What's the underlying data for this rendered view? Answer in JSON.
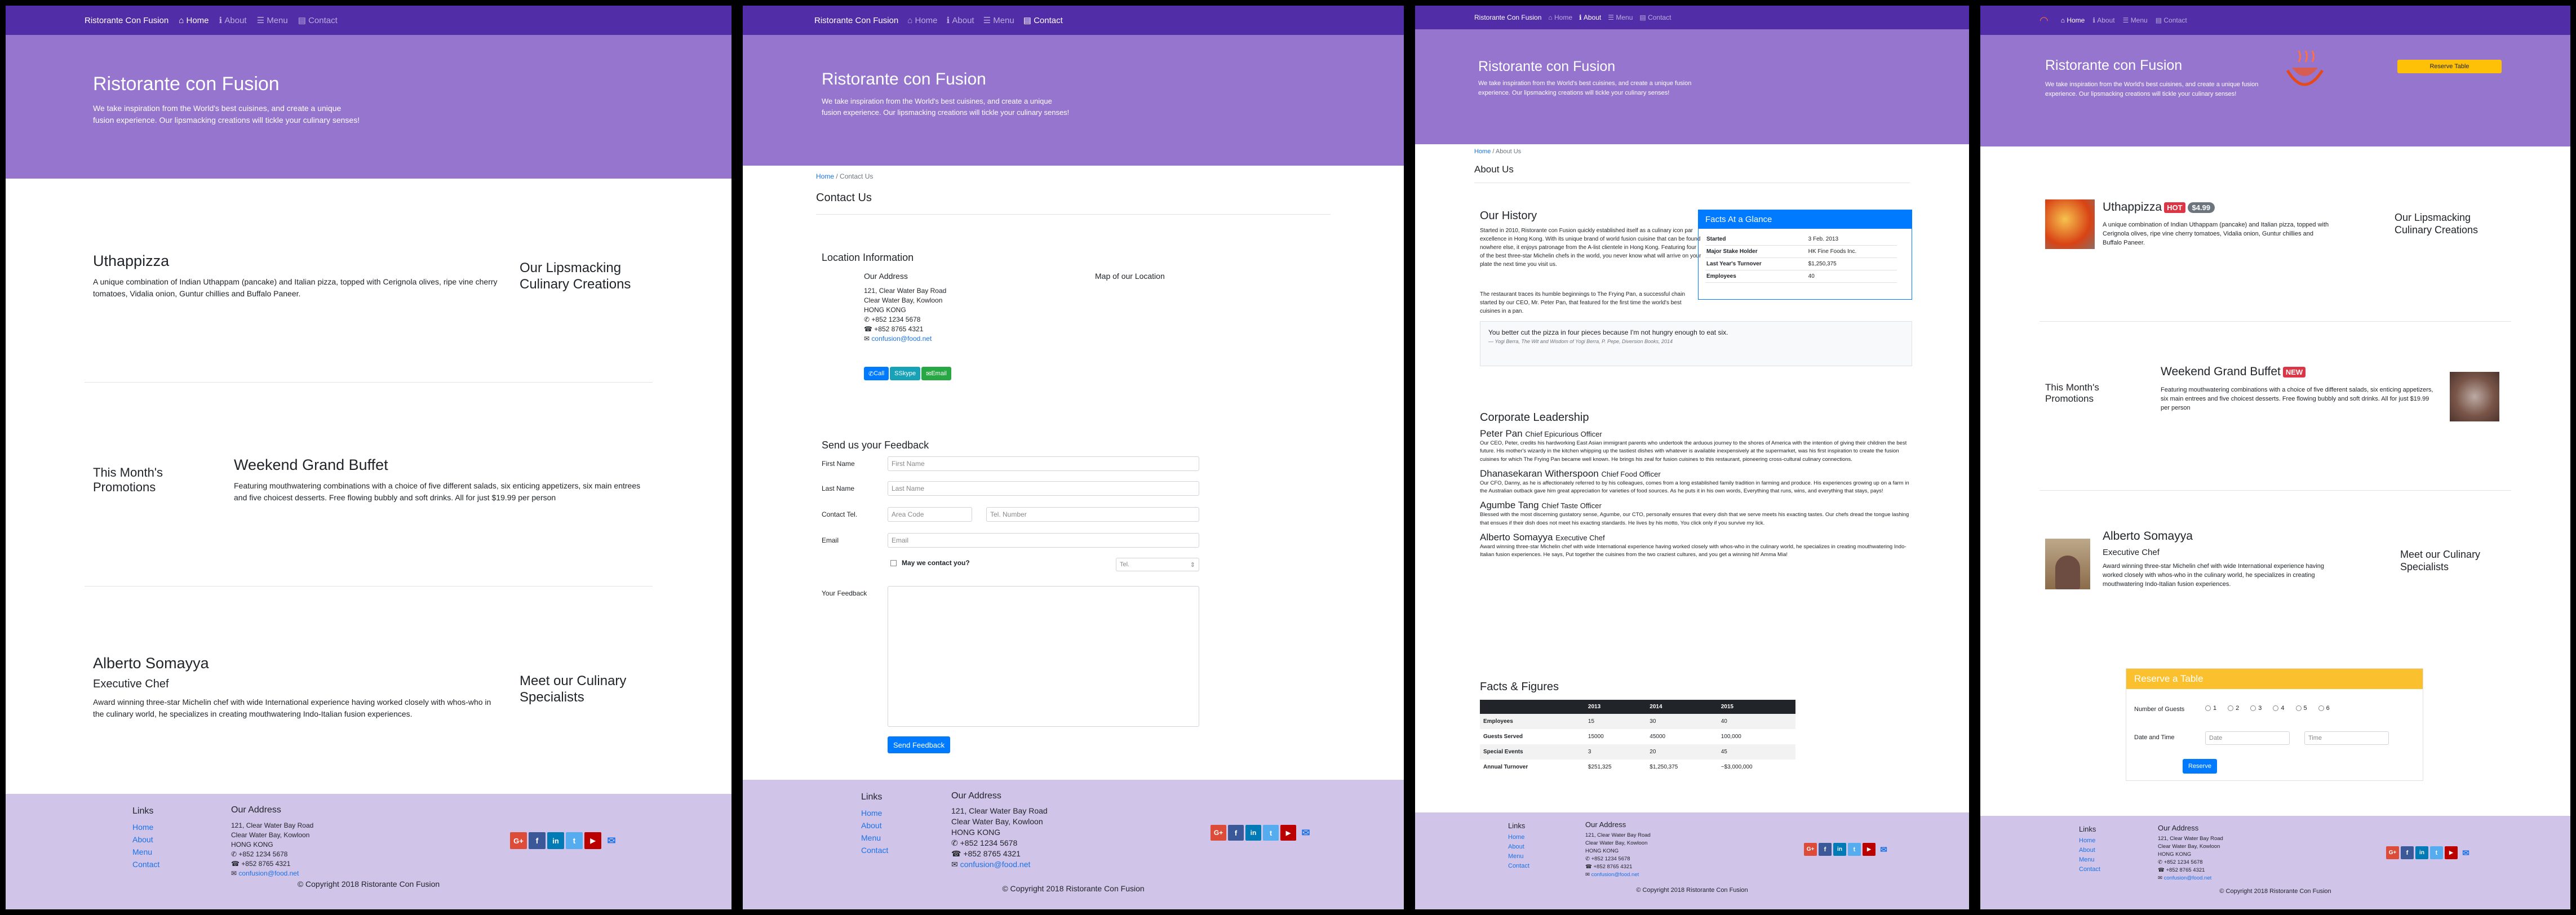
{
  "site": {
    "brand": "Ristorante Con Fusion",
    "nav": {
      "home": "Home",
      "about": "About",
      "menu": "Menu",
      "contact": "Contact"
    },
    "jumbo_title": "Ristorante con Fusion",
    "jumbo_text": "We take inspiration from the World's best cuisines, and create a unique fusion experience. Our lipsmacking creations will tickle your culinary senses!",
    "colors": {
      "nav": "#512da8",
      "jumbotron": "#9575cd",
      "footer": "#d1c4e9",
      "link": "#1a73e8"
    }
  },
  "footer": {
    "links_title": "Links",
    "links": [
      "Home",
      "About",
      "Menu",
      "Contact"
    ],
    "address_title": "Our Address",
    "address": [
      "121, Clear Water Bay Road",
      "Clear Water Bay, Kowloon",
      "HONG KONG"
    ],
    "phone": "+852 1234 5678",
    "fax": "+852 8765 4321",
    "email": "confusion@food.net",
    "copyright": "© Copyright 2018 Ristorante Con Fusion",
    "social": [
      "google-plus-icon",
      "facebook-icon",
      "linkedin-icon",
      "twitter-icon",
      "youtube-icon",
      "mail-icon"
    ]
  },
  "home": {
    "dish_title": "Uthappizza",
    "dish_text": "A unique combination of Indian Uthappam (pancake) and Italian pizza, topped with Cerignola olives, ripe vine cherry tomatoes, Vidalia onion, Guntur chillies and Buffalo Paneer.",
    "dish_side": "Our Lipsmacking Culinary Creations",
    "promo_side": "This Month's Promotions",
    "promo_title": "Weekend Grand Buffet",
    "promo_text": "Featuring mouthwatering combinations with a choice of five different salads, six enticing appetizers, six main entrees and five choicest desserts. Free flowing bubbly and soft drinks. All for just $19.99 per person",
    "leader_name": "Alberto Somayya",
    "leader_role": "Executive Chef",
    "leader_text": "Award winning three-star Michelin chef with wide International experience having worked closely with whos-who in the culinary world, he specializes in creating mouthwatering Indo-Italian fusion experiences.",
    "leader_side": "Meet our Culinary Specialists",
    "hot_badge": "HOT",
    "price_badge": "$4.99",
    "new_badge": "NEW",
    "reserve_button": "Reserve Table"
  },
  "contact": {
    "breadcrumb_home": "Home",
    "breadcrumb_current": "Contact Us",
    "title": "Contact Us",
    "location_title": "Location Information",
    "address_title": "Our Address",
    "map_title": "Map of our Location",
    "buttons": {
      "call": "Call",
      "skype": "Skype",
      "email": "Email"
    },
    "feedback_title": "Send us your Feedback",
    "labels": {
      "first": "First Name",
      "last": "Last Name",
      "tel": "Contact Tel.",
      "email": "Email",
      "feedback": "Your Feedback",
      "may": "May we contact you?"
    },
    "placeholders": {
      "first": "First Name",
      "last": "Last Name",
      "area": "Area Code",
      "tel": "Tel. Number",
      "email": "Email"
    },
    "select_value": "Tel.",
    "submit": "Send Feedback"
  },
  "about": {
    "breadcrumb_home": "Home",
    "breadcrumb_current": "About Us",
    "title": "About Us",
    "history_title": "Our History",
    "history_p1": "Started in 2010, Ristorante con Fusion quickly established itself as a culinary icon par excellence in Hong Kong. With its unique brand of world fusion cuisine that can be found nowhere else, it enjoys patronage from the A-list clientele in Hong Kong. Featuring four of the best three-star Michelin chefs in the world, you never know what will arrive on your plate the next time you visit us.",
    "history_p2": "The restaurant traces its humble beginnings to The Frying Pan, a successful chain started by our CEO, Mr. Peter Pan, that featured for the first time the world's best cuisines in a pan.",
    "facts_title": "Facts At a Glance",
    "facts": [
      [
        "Started",
        "3 Feb. 2013"
      ],
      [
        "Major Stake Holder",
        "HK Fine Foods Inc."
      ],
      [
        "Last Year's Turnover",
        "$1,250,375"
      ],
      [
        "Employees",
        "40"
      ]
    ],
    "quote": "You better cut the pizza in four pieces because I'm not hungry enough to eat six.",
    "quote_source": "— Yogi Berra, The Wit and Wisdom of Yogi Berra, P. Pepe, Diversion Books, 2014",
    "leadership_title": "Corporate Leadership",
    "leaders": [
      {
        "name": "Peter Pan",
        "role": "Chief Epicurious Officer",
        "text": "Our CEO, Peter, credits his hardworking East Asian immigrant parents who undertook the arduous journey to the shores of America with the intention of giving their children the best future. His mother's wizardy in the kitchen whipping up the tastiest dishes with whatever is available inexpensively at the supermarket, was his first inspiration to create the fusion cuisines for which The Frying Pan became well known. He brings his zeal for fusion cuisines to this restaurant, pioneering cross-cultural culinary connections."
      },
      {
        "name": "Dhanasekaran Witherspoon",
        "role": "Chief Food Officer",
        "text": "Our CFO, Danny, as he is affectionately referred to by his colleagues, comes from a long established family tradition in farming and produce. His experiences growing up on a farm in the Australian outback gave him great appreciation for varieties of food sources. As he puts it in his own words, Everything that runs, wins, and everything that stays, pays!"
      },
      {
        "name": "Agumbe Tang",
        "role": "Chief Taste Officer",
        "text": "Blessed with the most discerning gustatory sense, Agumbe, our CTO, personally ensures that every dish that we serve meets his exacting tastes. Our chefs dread the tongue lashing that ensues if their dish does not meet his exacting standards. He lives by his motto, You click only if you survive my lick."
      },
      {
        "name": "Alberto Somayya",
        "role": "Executive Chef",
        "text": "Award winning three-star Michelin chef with wide International experience having worked closely with whos-who in the culinary world, he specializes in creating mouthwatering Indo-Italian fusion experiences. He says, Put together the cuisines from the two craziest cultures, and you get a winning hit! Amma Mia!"
      }
    ],
    "figures_title": "Facts & Figures",
    "figures_head": [
      "",
      "2013",
      "2014",
      "2015"
    ],
    "figures_rows": [
      [
        "Employees",
        "15",
        "30",
        "40"
      ],
      [
        "Guests Served",
        "15000",
        "45000",
        "100,000"
      ],
      [
        "Special Events",
        "3",
        "20",
        "45"
      ],
      [
        "Annual Turnover",
        "$251,325",
        "$1,250,375",
        "~$3,000,000"
      ]
    ]
  },
  "reserve": {
    "title": "Reserve a Table",
    "guests_label": "Number of Guests",
    "guests": [
      "1",
      "2",
      "3",
      "4",
      "5",
      "6"
    ],
    "datetime_label": "Date and Time",
    "date_placeholder": "Date",
    "time_placeholder": "Time",
    "button": "Reserve"
  }
}
